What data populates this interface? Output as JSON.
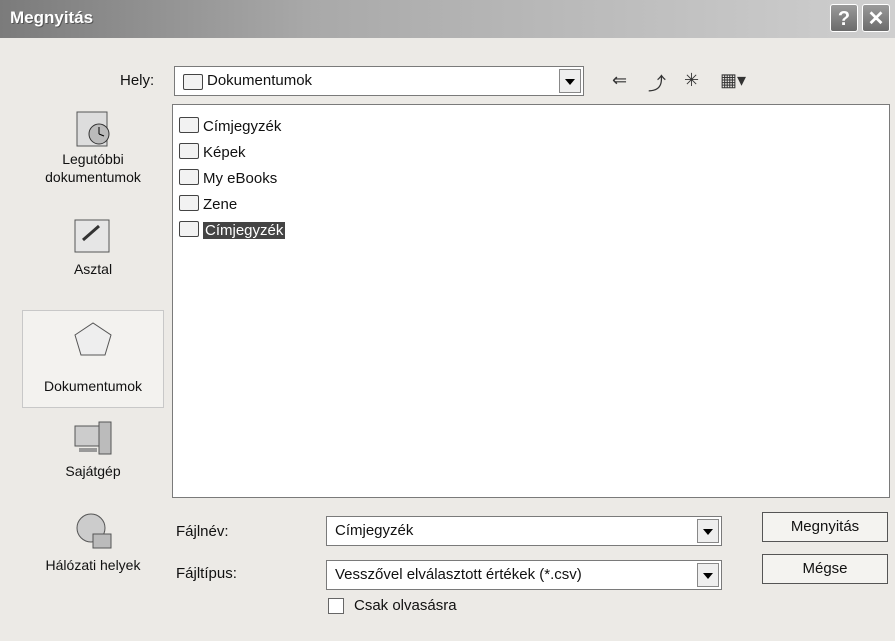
{
  "window": {
    "title": "Megnyitás",
    "help_label": "?",
    "close_label": "✕"
  },
  "location": {
    "label": "Hely:",
    "value": "Dokumentumok"
  },
  "toolbar": {
    "back_icon": "back-arrow-icon",
    "up_icon": "up-folder-icon",
    "new_folder_icon": "new-folder-icon",
    "view_icon": "view-menu-icon"
  },
  "places": [
    {
      "label": "Legutóbbi dokumentumok",
      "icon": "recent-documents-icon"
    },
    {
      "label": "Asztal",
      "icon": "desktop-icon"
    },
    {
      "label": "Dokumentumok",
      "icon": "documents-icon"
    },
    {
      "label": "Sajátgép",
      "icon": "computer-icon"
    },
    {
      "label": "Hálózati helyek",
      "icon": "network-icon"
    }
  ],
  "files": [
    {
      "name": "Címjegyzék",
      "selected": false
    },
    {
      "name": "Képek",
      "selected": false
    },
    {
      "name": "My eBooks",
      "selected": false
    },
    {
      "name": "Zene",
      "selected": false
    },
    {
      "name": "Címjegyzék",
      "selected": true
    }
  ],
  "filename": {
    "label": "Fájlnév:",
    "value": "Címjegyzék"
  },
  "filetype": {
    "label": "Fájltípus:",
    "value": "Vesszővel elválasztott értékek (*.csv)"
  },
  "readonly": {
    "label": "Csak olvasásra",
    "checked": false
  },
  "buttons": {
    "open": "Megnyitás",
    "cancel": "Mégse"
  }
}
